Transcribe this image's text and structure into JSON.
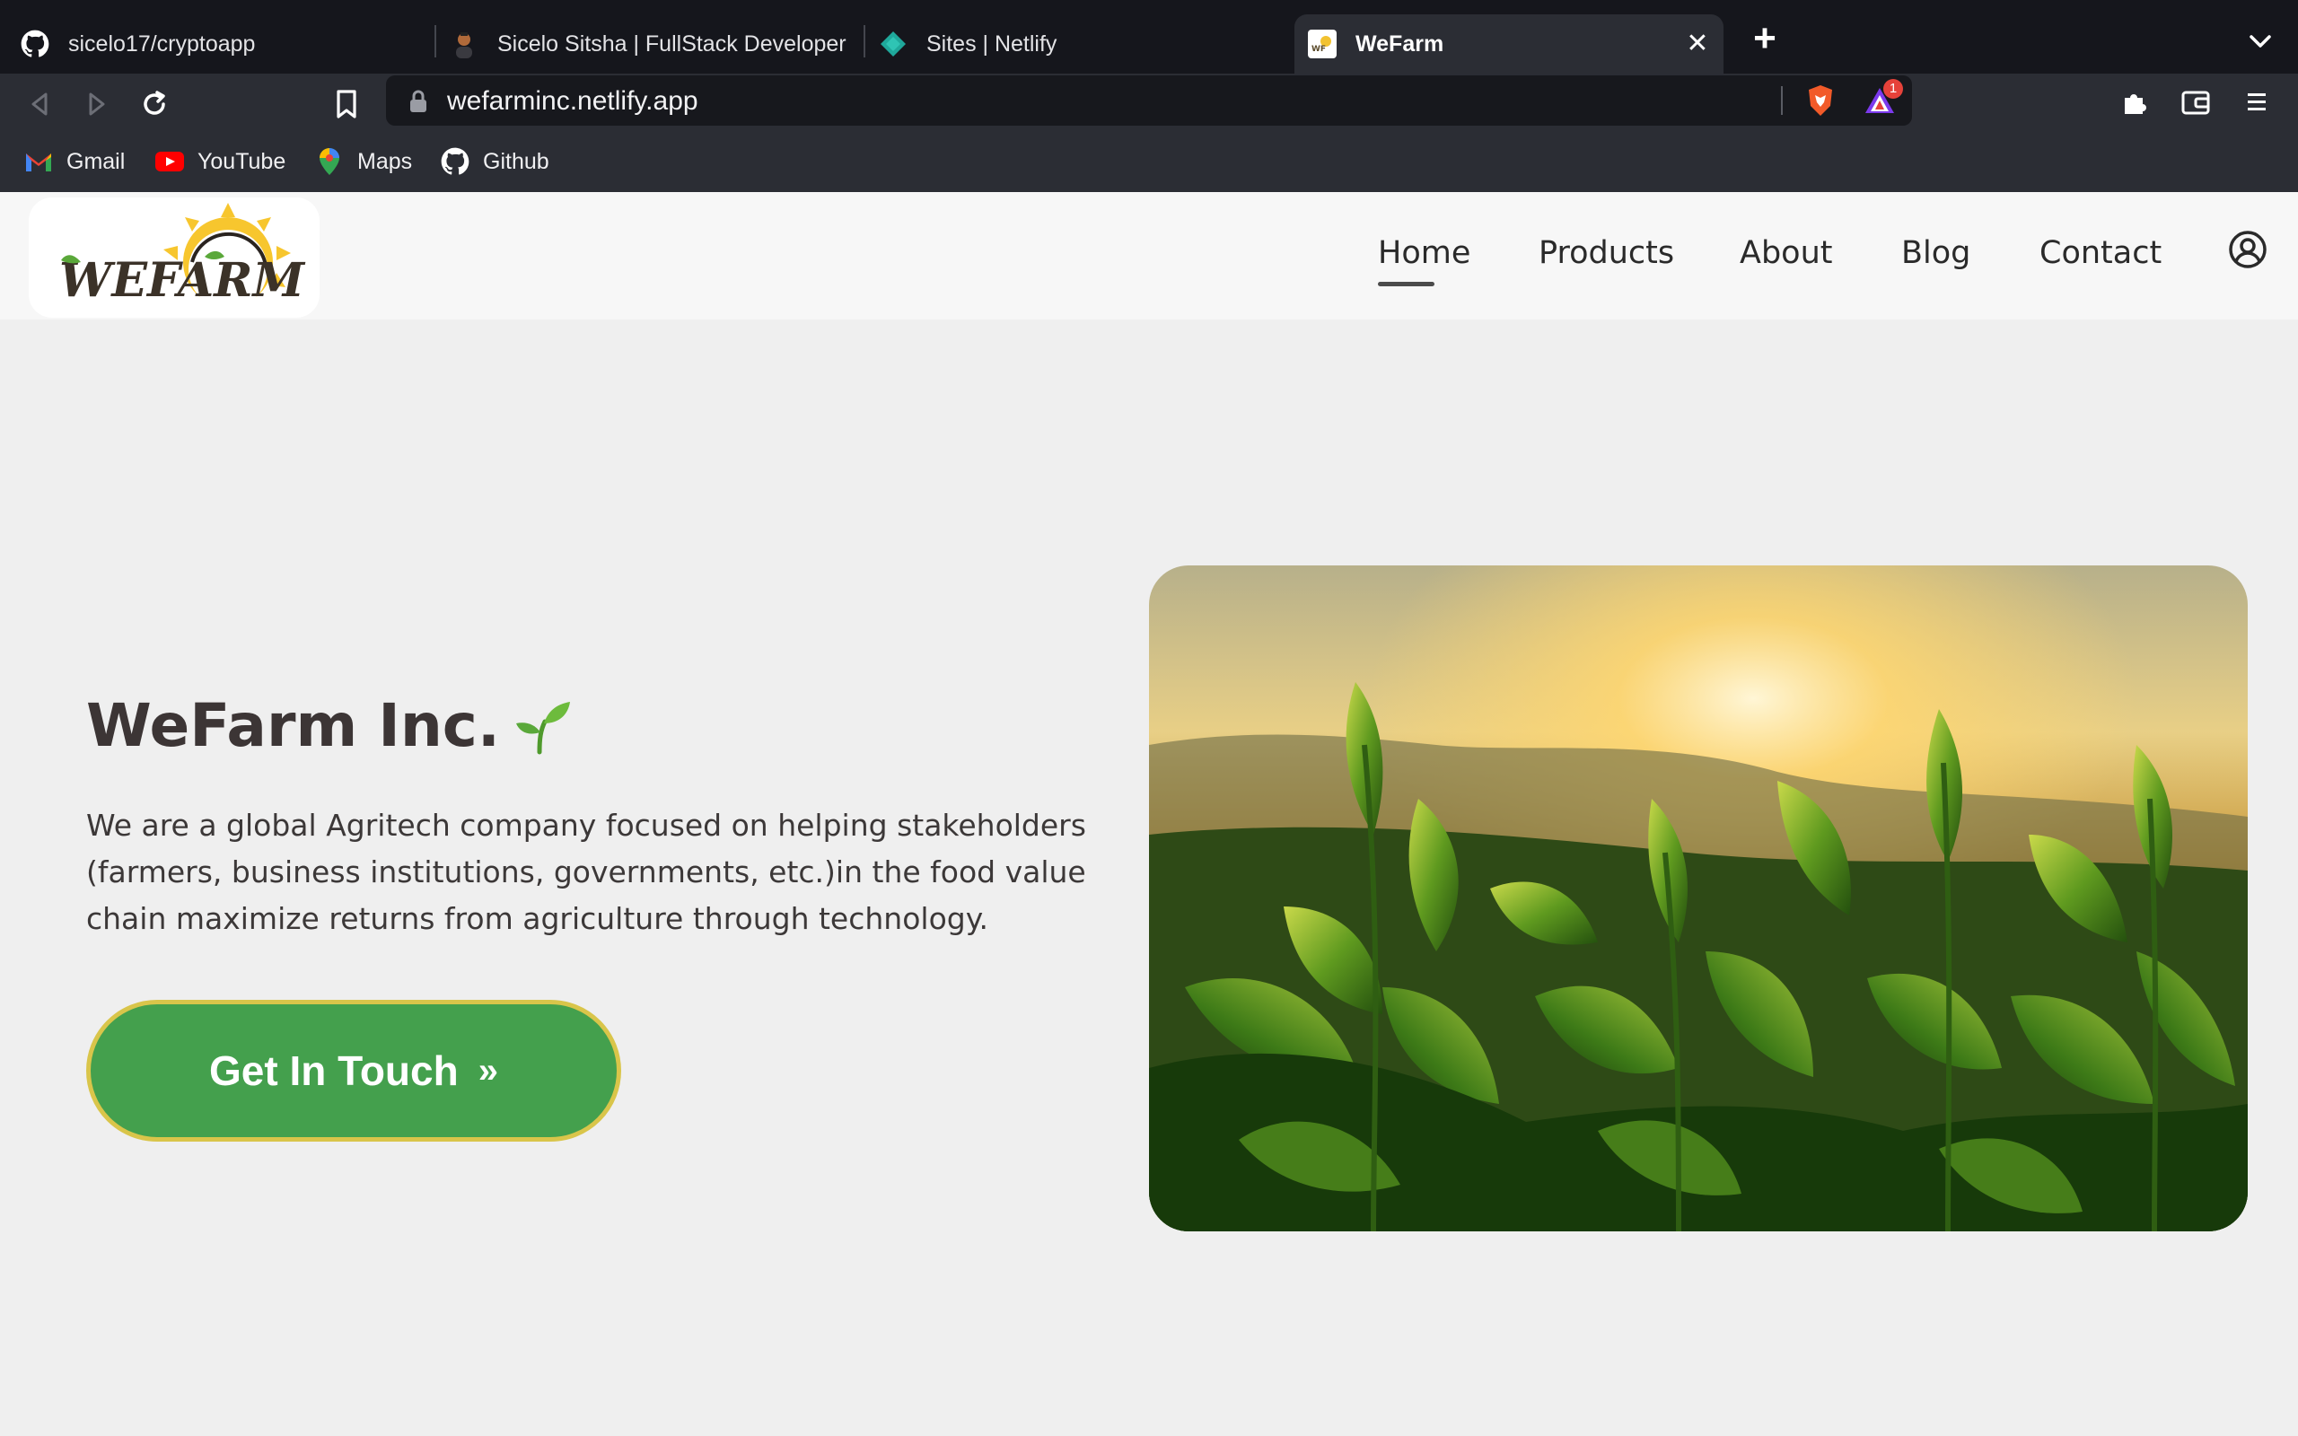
{
  "tabs": [
    {
      "title": "sicelo17/cryptoapp",
      "icon": "github-icon"
    },
    {
      "title": "Sicelo Sitsha | FullStack Developer",
      "icon": "profile-avatar-icon"
    },
    {
      "title": "Sites | Netlify",
      "icon": "netlify-icon"
    },
    {
      "title": "WeFarm",
      "icon": "wefarm-favicon",
      "active": true
    }
  ],
  "toolbar": {
    "url": "wefarminc.netlify.app",
    "rewards_badge": "1"
  },
  "bookmarks": [
    {
      "label": "Gmail",
      "icon": "gmail-icon"
    },
    {
      "label": "YouTube",
      "icon": "youtube-icon"
    },
    {
      "label": "Maps",
      "icon": "maps-icon"
    },
    {
      "label": "Github",
      "icon": "github-icon"
    }
  ],
  "site": {
    "logo_text": "WEFARM",
    "nav": [
      "Home",
      "Products",
      "About",
      "Blog",
      "Contact"
    ],
    "active_nav": "Home",
    "hero": {
      "title": "WeFarm Inc.",
      "description": "We are a global Agritech company focused on helping stakeholders (farmers, business institutions, governments, etc.)in the food value chain maximize returns from agriculture through technology.",
      "cta_label": "Get In Touch",
      "cta_icon": "»"
    }
  },
  "colors": {
    "accent_green": "#44a04d",
    "cta_border": "#d9c54a",
    "text_dark": "#3c3535"
  }
}
